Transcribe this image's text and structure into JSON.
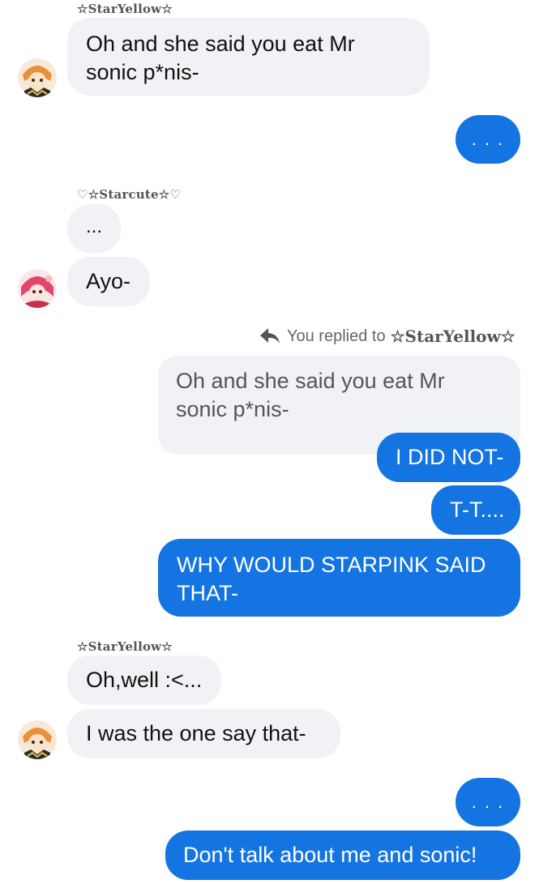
{
  "messages": {
    "sender1": "☆StarYellow☆",
    "m1": "Oh and she said you eat Mr\nsonic p*nis-",
    "m2": ". . .",
    "sender2": "♡☆Starcute☆♡",
    "m3": "...",
    "m4": "Ayo-",
    "reply_note_prefix": "You replied to",
    "reply_note_name": "☆StarYellow☆",
    "quoted": "Oh and she said you eat Mr\nsonic p*nis-",
    "m5": "I DID NOT-",
    "m6": "T-T....",
    "m7": "WHY WOULD STARPINK SAID\nTHAT-",
    "sender3": "☆StarYellow☆",
    "m8": "Oh,well :<...",
    "m9": "I was the one say that-",
    "m10": ". . .",
    "m11": "Don't talk about me and sonic!"
  },
  "colors": {
    "outgoing_bubble": "#1474e1",
    "incoming_bubble": "#f1f2f5",
    "outgoing_text": "#ffffff",
    "incoming_text": "#111111"
  },
  "icons": {
    "reply": "reply-arrow-icon",
    "avatar_yellow": "avatar-staryellow",
    "avatar_pink": "avatar-starcute"
  }
}
